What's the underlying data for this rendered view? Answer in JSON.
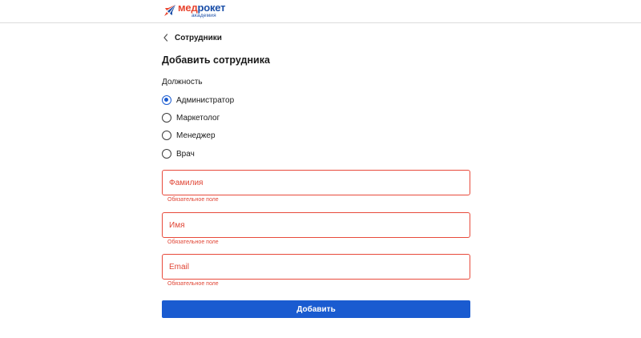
{
  "header": {
    "logo": {
      "main_part1": "мед",
      "main_part2": "рокет",
      "sub": "академия",
      "icon": "rocket-icon"
    }
  },
  "nav": {
    "back_label": "Сотрудники",
    "back_icon": "chevron-left-icon"
  },
  "page": {
    "title": "Добавить сотрудника"
  },
  "role": {
    "label": "Должность",
    "options": [
      {
        "label": "Администратор",
        "checked": true
      },
      {
        "label": "Маркетолог",
        "checked": false
      },
      {
        "label": "Менеджер",
        "checked": false
      },
      {
        "label": "Врач",
        "checked": false
      }
    ]
  },
  "fields": {
    "last_name": {
      "placeholder": "Фамилия",
      "value": "",
      "error": "Обязательное поле"
    },
    "first_name": {
      "placeholder": "Имя",
      "value": "",
      "error": "Обязательное поле"
    },
    "email": {
      "placeholder": "Email",
      "value": "",
      "error": "Обязательное поле"
    }
  },
  "actions": {
    "submit_label": "Добавить"
  },
  "colors": {
    "accent": "#1a5bd0",
    "error": "#e04535",
    "logo_red": "#e8452f",
    "logo_blue": "#1b4fa8"
  }
}
